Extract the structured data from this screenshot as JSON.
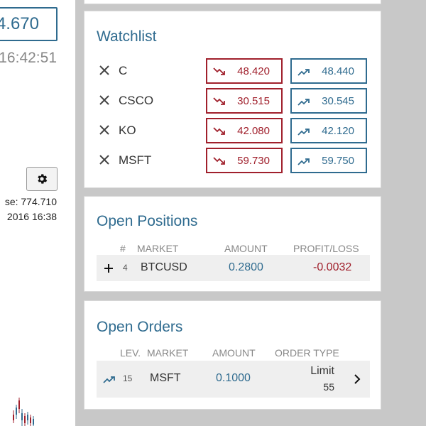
{
  "left": {
    "price": "4.670",
    "clock": "16:42:51",
    "stat_1": "se: 774.710",
    "stat_2": "2016 16:38"
  },
  "watchlist": {
    "title": "Watchlist",
    "rows": [
      {
        "symbol": "C",
        "sell": "48.420",
        "buy": "48.440"
      },
      {
        "symbol": "CSCO",
        "sell": "30.515",
        "buy": "30.545"
      },
      {
        "symbol": "KO",
        "sell": "42.080",
        "buy": "42.120"
      },
      {
        "symbol": "MSFT",
        "sell": "59.730",
        "buy": "59.750"
      }
    ]
  },
  "positions": {
    "title": "Open Positions",
    "headers": {
      "num": "#",
      "market": "MARKET",
      "amount": "AMOUNT",
      "pl": "PROFIT/LOSS"
    },
    "rows": [
      {
        "num": "4",
        "market": "BTCUSD",
        "amount": "0.2800",
        "pl": "-0.0032"
      }
    ]
  },
  "orders": {
    "title": "Open Orders",
    "headers": {
      "lev": "LEV.",
      "market": "MARKET",
      "amount": "AMOUNT",
      "type": "ORDER TYPE"
    },
    "rows": [
      {
        "lev": "15",
        "market": "MSFT",
        "amount": "0.1000",
        "type": "Limit",
        "type_value": "55"
      }
    ]
  },
  "colors": {
    "accent": "#2f6b8f",
    "sell": "#a0202c",
    "background": "#c8c8c8"
  }
}
